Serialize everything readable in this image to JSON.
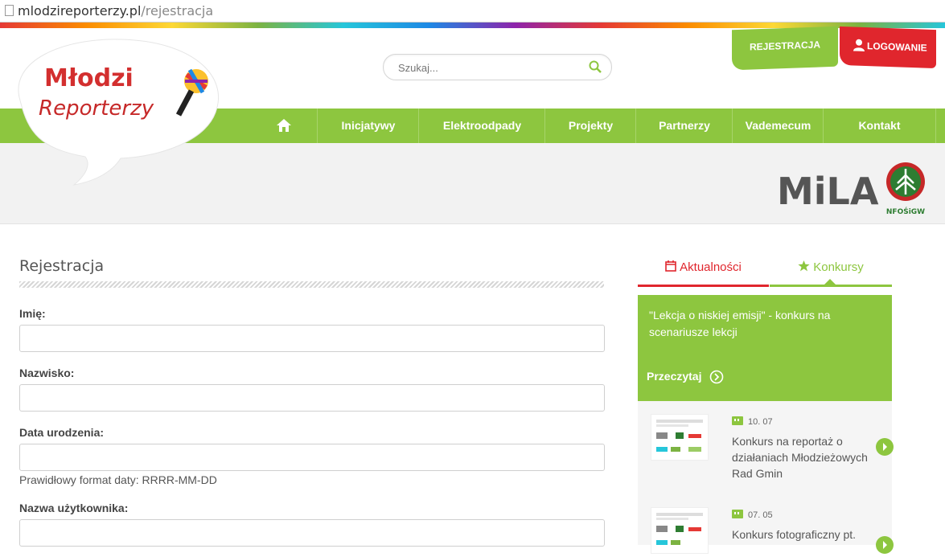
{
  "browser": {
    "url_domain": "mlodzireporterzy.pl",
    "url_path": "/rejestracja"
  },
  "logo": {
    "line1": "Młodzi",
    "line2": "Reporterzy"
  },
  "search": {
    "placeholder": "Szukaj..."
  },
  "top_buttons": {
    "register": "REJESTRACJA",
    "login": "LOGOWANIE"
  },
  "nav": {
    "home_icon": "home-icon",
    "items": [
      "Inicjatywy",
      "Elektroodpady",
      "Projekty",
      "Partnerzy",
      "Vademecum",
      "Kontakt"
    ]
  },
  "partners": {
    "mila": "MiLA",
    "nfos": "NFOŚiGW"
  },
  "form": {
    "title": "Rejestracja",
    "fields": [
      {
        "label": "Imię:"
      },
      {
        "label": "Nazwisko:"
      },
      {
        "label": "Data urodzenia:",
        "hint": "Prawidłowy format daty: RRRR-MM-DD"
      },
      {
        "label": "Nazwa użytkownika:"
      }
    ]
  },
  "sidebar": {
    "tabs": [
      {
        "label": "Aktualności",
        "icon": "calendar-icon",
        "color": "#e0262d"
      },
      {
        "label": "Konkursy",
        "icon": "star-icon",
        "color": "#8dc63f"
      }
    ],
    "feature": {
      "title": "\"Lekcja o niskiej emisji\" - konkurs na scenariusze lekcji",
      "more": "Przeczytaj"
    },
    "news": [
      {
        "date": "10. 07",
        "title": "Konkurs na reportaż o działaniach Młodzieżowych Rad Gmin"
      },
      {
        "date": "07. 05",
        "title": "Konkurs fotograficzny pt."
      }
    ]
  },
  "colors": {
    "green": "#8dc63f",
    "red": "#e0262d"
  }
}
